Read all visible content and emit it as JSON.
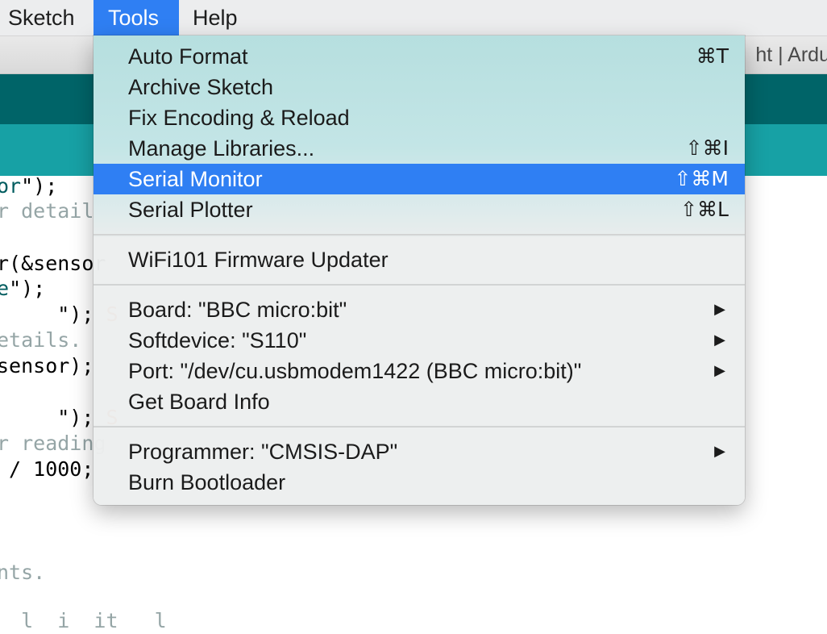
{
  "menubar": {
    "items": [
      {
        "label": "Sketch"
      },
      {
        "label": "Tools"
      },
      {
        "label": "Help"
      }
    ]
  },
  "window": {
    "title_fragment": "ht | Ardu"
  },
  "editor": {
    "lines": [
      {
        "parts": [
          "or",
          "\");"
        ]
      },
      {
        "parts": [
          "r details"
        ]
      },
      {
        "parts": [
          "r(&sensor"
        ]
      },
      {
        "parts": [
          "e",
          "\");"
        ]
      },
      {
        "parts": [
          "     \"); ",
          "S"
        ]
      },
      {
        "parts": [
          "etails."
        ]
      },
      {
        "parts": [
          "sensor);"
        ]
      },
      {
        "parts": [
          "     \"); ",
          "S"
        ]
      },
      {
        "parts": [
          "r reading"
        ]
      },
      {
        "parts": [
          " / 1000;"
        ]
      },
      {
        "parts": [
          "nts."
        ]
      },
      {
        "parts": [
          "  l  i  it   l"
        ]
      }
    ]
  },
  "tools_menu": {
    "items": [
      {
        "label": "Auto Format",
        "shortcut": "⌘T"
      },
      {
        "label": "Archive Sketch",
        "shortcut": ""
      },
      {
        "label": "Fix Encoding & Reload",
        "shortcut": ""
      },
      {
        "label": "Manage Libraries...",
        "shortcut": "⇧⌘I"
      },
      {
        "label": "Serial Monitor",
        "shortcut": "⇧⌘M",
        "highlighted": true
      },
      {
        "label": "Serial Plotter",
        "shortcut": "⇧⌘L"
      },
      {
        "label": "WiFi101 Firmware Updater",
        "shortcut": ""
      },
      {
        "label": "Board: \"BBC micro:bit\"",
        "submenu": true
      },
      {
        "label": "Softdevice: \"S110\"",
        "submenu": true
      },
      {
        "label": "Port: \"/dev/cu.usbmodem1422 (BBC micro:bit)\"",
        "submenu": true
      },
      {
        "label": "Get Board Info",
        "shortcut": ""
      },
      {
        "label": "Programmer: \"CMSIS-DAP\"",
        "submenu": true
      },
      {
        "label": "Burn Bootloader",
        "shortcut": ""
      }
    ],
    "submenu_arrow": "▶"
  },
  "colors": {
    "menu_highlight": "#2f7ff3",
    "toolbar_dark_teal": "#006468",
    "tabbar_teal": "#17a1a5",
    "code_orange": "#d35400",
    "code_comment": "#95a5a6"
  }
}
